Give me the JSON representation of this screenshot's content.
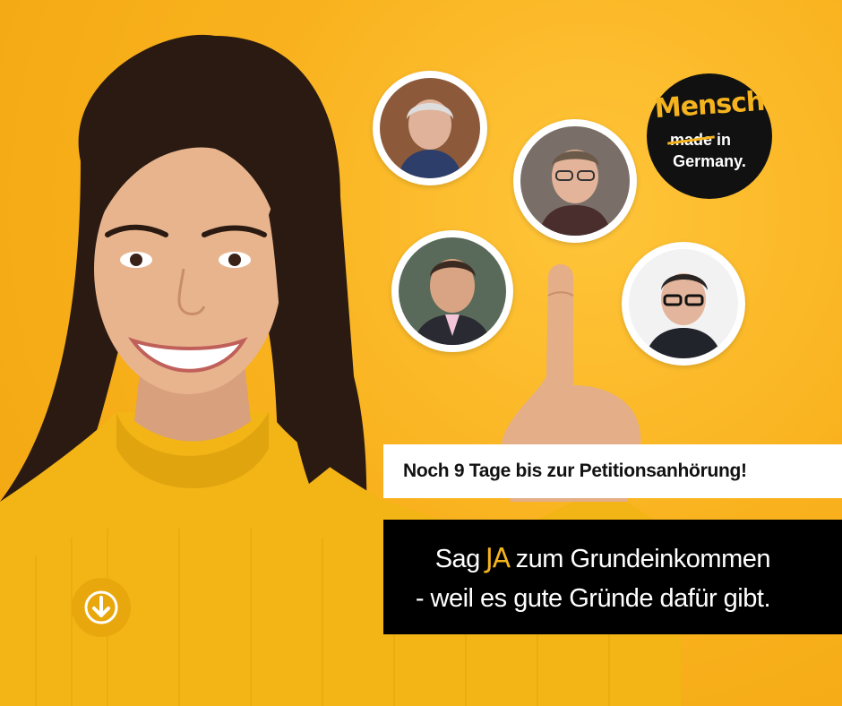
{
  "logo": {
    "word1": "Mensch",
    "word2_struck": "made",
    "word2_rest": "in",
    "word3": "Germany."
  },
  "banner_white": {
    "text": "Noch 9 Tage bis zur Petitionsanhörung!"
  },
  "banner_black": {
    "line1_before": "Sag",
    "line1_highlight": "JA",
    "line1_after": "zum Grundeinkommen",
    "line2": "-  weil es gute Gründe dafür gibt."
  },
  "colors": {
    "background": "#f9b21e",
    "accent": "#f5b41e",
    "banner_dark": "#000000",
    "banner_light": "#ffffff",
    "button": "#e8a70c"
  },
  "icons": {
    "scroll_button": "arrow-down-circle-icon"
  }
}
